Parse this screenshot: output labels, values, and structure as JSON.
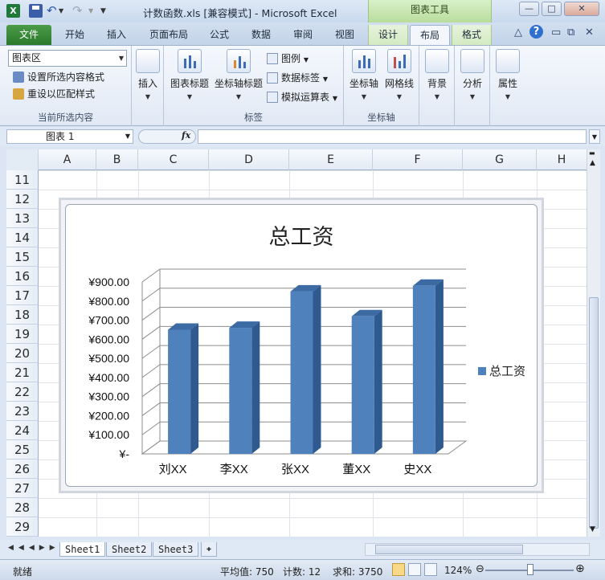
{
  "titlebar": {
    "app_icon": "X",
    "window_title": "计数函数.xls  [兼容模式]  -  Microsoft Excel",
    "context_banner": "图表工具",
    "minimize": "—",
    "maximize": "□",
    "close": "✕"
  },
  "tabs": {
    "file": "文件",
    "home": "开始",
    "insert": "插入",
    "page_layout": "页面布局",
    "formulas": "公式",
    "data": "数据",
    "review": "审阅",
    "view": "视图",
    "design": "设计",
    "layout": "布局",
    "format": "格式"
  },
  "ribbon": {
    "current_selection": {
      "dropdown_value": "图表区",
      "format_selection": "设置所选内容格式",
      "reset_style": "重设以匹配样式",
      "group_label": "当前所选内容"
    },
    "insert": {
      "label": "插入"
    },
    "labels": {
      "chart_title": "图表标题",
      "axis_titles": "坐标轴标题",
      "legend": "图例",
      "data_labels": "数据标签",
      "data_table": "模拟运算表",
      "group_label": "标签"
    },
    "axes": {
      "axes": "坐标轴",
      "gridlines": "网格线",
      "group_label": "坐标轴"
    },
    "background": {
      "label": "背景"
    },
    "analysis": {
      "label": "分析"
    },
    "properties": {
      "label": "属性"
    }
  },
  "formula_bar": {
    "name_box": "图表 1",
    "fx": "fx",
    "formula": ""
  },
  "grid": {
    "columns": [
      "A",
      "B",
      "C",
      "D",
      "E",
      "F",
      "G",
      "H"
    ],
    "rows": [
      "11",
      "12",
      "13",
      "14",
      "15",
      "16",
      "17",
      "18",
      "19",
      "20",
      "21",
      "22",
      "23",
      "24",
      "25",
      "26",
      "27",
      "28",
      "29"
    ]
  },
  "chart_data": {
    "type": "bar",
    "title": "总工资",
    "categories": [
      "刘XX",
      "李XX",
      "张XX",
      "董XX",
      "史XX"
    ],
    "series": [
      {
        "name": "总工资",
        "values": [
          650,
          660,
          850,
          720,
          880
        ],
        "color": "#4f81bd"
      }
    ],
    "ylim": [
      0,
      900
    ],
    "y_ticks": [
      "¥-",
      "¥100.00",
      "¥200.00",
      "¥300.00",
      "¥400.00",
      "¥500.00",
      "¥600.00",
      "¥700.00",
      "¥800.00",
      "¥900.00"
    ],
    "grid": true,
    "legend_position": "right",
    "style": "3d-column"
  },
  "sheets": {
    "tabs": [
      "Sheet1",
      "Sheet2",
      "Sheet3"
    ],
    "active": "Sheet1"
  },
  "status": {
    "ready": "就绪",
    "average": "平均值: 750",
    "count": "计数: 12",
    "sum": "求和: 3750",
    "zoom": "124%"
  }
}
